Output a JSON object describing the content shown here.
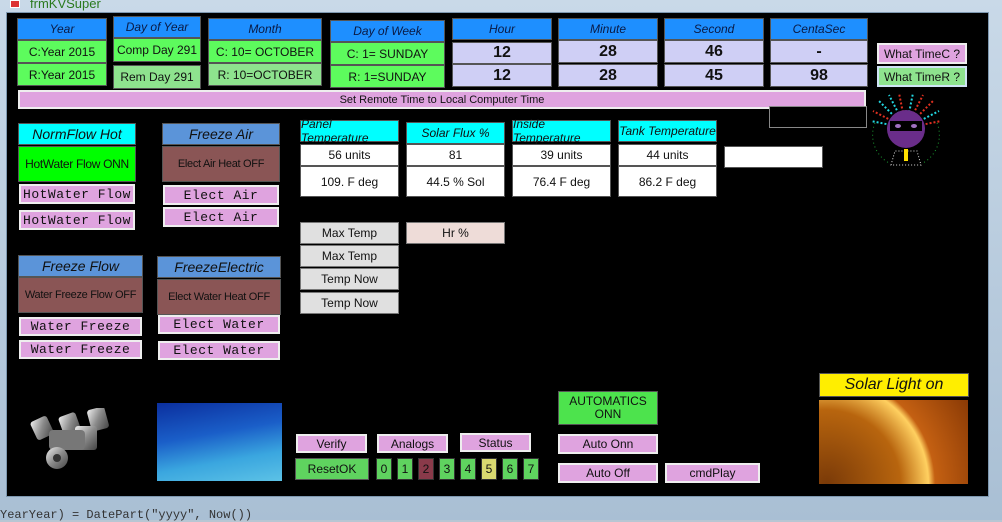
{
  "window": {
    "title": "frmKVSuper"
  },
  "time_grid": {
    "columns": [
      {
        "header": "Year",
        "computer": "C:Year 2015",
        "remote": "R:Year 2015"
      },
      {
        "header": "Day of Year",
        "computer": "Comp Day 291",
        "remote": "Rem Day 291"
      },
      {
        "header": "Month",
        "computer": "C:  10= OCTOBER",
        "remote": "R: 10=OCTOBER"
      },
      {
        "header": "Day of Week",
        "computer": "C:  1= SUNDAY",
        "remote": "R:  1=SUNDAY"
      },
      {
        "header": "Hour",
        "computer": "12",
        "remote": "12"
      },
      {
        "header": "Minute",
        "computer": "28",
        "remote": "28"
      },
      {
        "header": "Second",
        "computer": "46",
        "remote": "45"
      },
      {
        "header": "CentaSec",
        "computer": "-",
        "remote": "98"
      }
    ],
    "what_time_c_label": "What TimeC ?",
    "what_time_r_label": "What TimeR ?",
    "set_remote_label": "Set Remote Time to Local Computer Time",
    "remote_status_text": ""
  },
  "controls": {
    "normflow_hot": {
      "header": "NormFlow Hot",
      "status": "HotWater Flow ONN",
      "button1": "HotWater Flow",
      "button2": "HotWater Flow"
    },
    "freeze_air": {
      "header": "Freeze Air",
      "status": "Elect Air Heat OFF",
      "button1": "Elect Air",
      "button2": "Elect Air"
    },
    "freeze_flow": {
      "header": "Freeze Flow",
      "status": "Water Freeze Flow OFF",
      "button1": "Water Freeze",
      "button2": "Water Freeze"
    },
    "freeze_electric": {
      "header": "FreezeElectric",
      "status": "Elect Water Heat OFF",
      "button1": "Elect Water",
      "button2": "Elect Water"
    }
  },
  "sensors": [
    {
      "header": "Panel Temperature",
      "units": "56 units",
      "value": "109. F deg"
    },
    {
      "header": "Solar Flux %",
      "units": "81",
      "value": "44.5 % Sol"
    },
    {
      "header": "Inside Temperature",
      "units": "39 units",
      "value": "76.4 F deg"
    },
    {
      "header": "Tank Temperature",
      "units": "44 units",
      "value": "86.2 F deg"
    }
  ],
  "sensor_extra_box": "",
  "temp_buttons": [
    "Max Temp",
    "Max Temp",
    "Temp Now",
    "Temp Now"
  ],
  "hr_percent_label": "Hr  %",
  "bottom": {
    "verify_label": "Verify",
    "analogs_label": "Analogs",
    "status_label": "Status",
    "reset_label": "ResetOK",
    "bits": [
      {
        "label": "0",
        "color": "#5fd35f"
      },
      {
        "label": "1",
        "color": "#5fd35f"
      },
      {
        "label": "2",
        "color": "#8a3a4a"
      },
      {
        "label": "3",
        "color": "#5fd35f"
      },
      {
        "label": "4",
        "color": "#5fd35f"
      },
      {
        "label": "5",
        "color": "#d8d870"
      },
      {
        "label": "6",
        "color": "#5fd35f"
      },
      {
        "label": "7",
        "color": "#5fd35f"
      }
    ],
    "automatics_status": "AUTOMATICS ONN",
    "auto_onn_label": "Auto Onn",
    "auto_off_label": "Auto Off",
    "cmd_play_label": "cmdPlay",
    "solar_light_label": "Solar Light on"
  },
  "images": {
    "engine": "engine-pistons-image",
    "ocean": "ocean-floor-image",
    "sun": "sun-surface-image",
    "avatar": "avatar-sunglasses-image"
  },
  "status_bar_code": "YearYear) = DatePart(\"yyyy\", Now())"
}
